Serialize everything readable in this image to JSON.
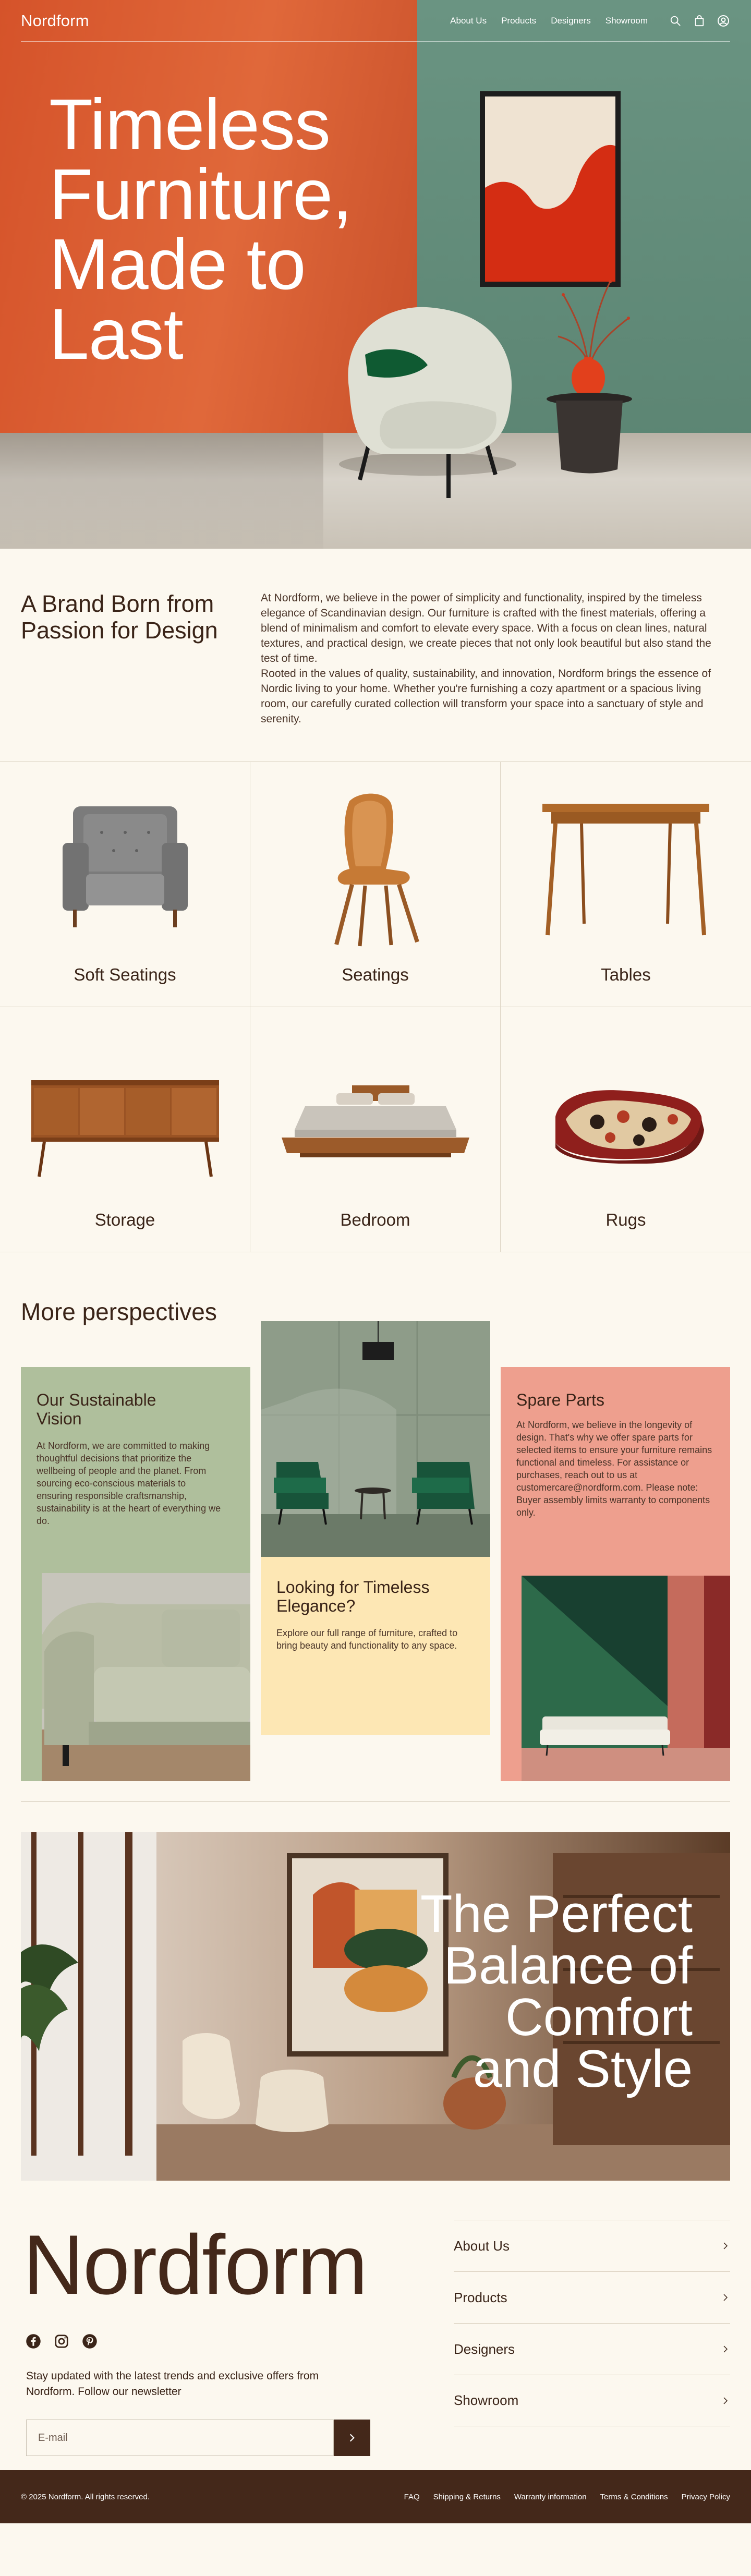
{
  "nav": {
    "brand": "Nordform",
    "links": [
      "About Us",
      "Products",
      "Designers",
      "Showroom"
    ],
    "icons": [
      "search-icon",
      "shopping-bag-icon",
      "user-icon"
    ]
  },
  "hero": {
    "title_lines": [
      "Timeless",
      "Furniture,",
      "Made to",
      "Last"
    ]
  },
  "brand": {
    "heading": "A Brand Born from Passion for Design",
    "paragraph1": "At Nordform, we believe in the power of simplicity and functionality, inspired by the timeless elegance of Scandinavian design. Our furniture is crafted with the finest materials, offering a blend of minimalism and comfort to elevate every space. With a focus on clean lines, natural textures, and practical design, we create pieces that not only look beautiful but also stand the test of time.",
    "paragraph2": "Rooted in the values of quality, sustainability, and innovation, Nordform brings the essence of Nordic living to your home. Whether you're furnishing a cozy apartment or a spacious living room, our carefully curated collection will transform your space into a sanctuary of style and serenity."
  },
  "categories": [
    {
      "label": "Soft Seatings",
      "icon": "armchair-image"
    },
    {
      "label": "Seatings",
      "icon": "chair-image"
    },
    {
      "label": "Tables",
      "icon": "table-image"
    },
    {
      "label": "Storage",
      "icon": "sideboard-image"
    },
    {
      "label": "Bedroom",
      "icon": "bed-image"
    },
    {
      "label": "Rugs",
      "icon": "rug-image"
    }
  ],
  "perspectives": {
    "heading": "More perspectives",
    "sustainable": {
      "title": "Our Sustainable Vision",
      "text": "At Nordform, we are committed to making thoughtful decisions that prioritize the wellbeing of people and the planet. From sourcing eco-conscious materials to ensuring responsible craftsmanship, sustainability is at the heart of everything we do."
    },
    "elegance": {
      "title": "Looking for Timeless Elegance?",
      "text": "Explore our full range of furniture, crafted to bring beauty and functionality to any space."
    },
    "spare": {
      "title": "Spare Parts",
      "text": "At Nordform, we believe in the longevity of design. That's why we offer spare parts for selected items to ensure your furniture remains functional and timeless. For assistance or purchases, reach out to us at customercare@nordform.com. Please note: Buyer assembly limits warranty to components only."
    }
  },
  "banner": {
    "title_lines": [
      "The Perfect",
      "Balance of",
      "Comfort",
      "and Style"
    ]
  },
  "footer": {
    "brand": "Nordform",
    "socials": [
      "facebook-icon",
      "instagram-icon",
      "pinterest-icon"
    ],
    "newsletter_text": "Stay updated with the latest trends and exclusive offers from Nordform. Follow our newsletter",
    "email_placeholder": "E-mail",
    "nav": [
      "About Us",
      "Products",
      "Designers",
      "Showroom"
    ],
    "copyright": "© 2025 Nordform. All rights reserved.",
    "legal": [
      "FAQ",
      "Shipping & Returns",
      "Warranty information",
      "Terms & Conditions",
      "Privacy Policy"
    ]
  },
  "colors": {
    "orange": "#d9582c",
    "green": "#5f8878",
    "cream": "#fcf8ef",
    "brown": "#44281a",
    "sage": "#afbf9c",
    "butter": "#fde7b4",
    "salmon": "#ee9f8e"
  }
}
